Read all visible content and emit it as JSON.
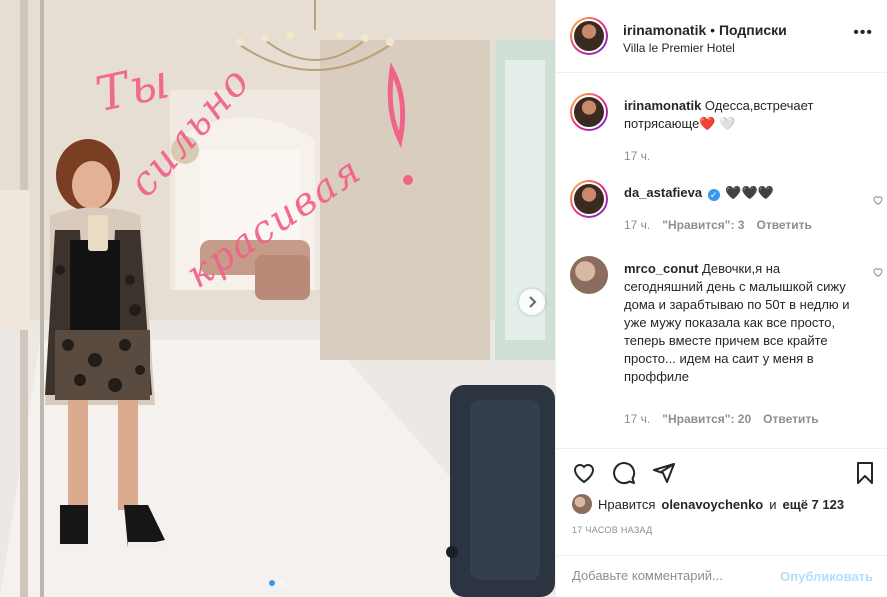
{
  "post": {
    "photo_alt": "",
    "lipstick_text": [
      "Ты",
      "сильно",
      "красивая"
    ],
    "carousel_dots": 2,
    "active_dot": 0
  },
  "header": {
    "username": "irinamonatik",
    "separator": "•",
    "follow_label": "Подписки",
    "location": "Villa le Premier Hotel",
    "more_icon": "more-horizontal-icon"
  },
  "caption": {
    "username": "irinamonatik",
    "text": "Одесса,встречает потрясающе",
    "emoji": "❤️ 🤍",
    "time": "17 ч."
  },
  "comments": [
    {
      "username": "da_astafieva",
      "verified": true,
      "text": "🖤🖤🖤",
      "time": "17 ч.",
      "likes_label": "\"Нравится\": 3",
      "reply_label": "Ответить"
    },
    {
      "username": "mrco_conut",
      "verified": false,
      "text": "Девочки,я на сегодняшний день с малышкой сижу дома и зарабтываю по 50т в недлю и уже мужу показала как все просто, теперь вместе причем все крайте просто... идем на саит у меня в проффиле",
      "time": "17 ч.",
      "likes_label": "\"Нравится\": 20",
      "reply_label": "Ответить"
    }
  ],
  "actions": {
    "like_icon": "heart-icon",
    "comment_icon": "comment-icon",
    "share_icon": "share-icon",
    "save_icon": "bookmark-icon"
  },
  "likes": {
    "prefix": "Нравится",
    "user": "olenavoychenko",
    "and": "и",
    "others": "ещё 7 123"
  },
  "timestamp": "17 ЧАСОВ НАЗАД",
  "add_comment": {
    "placeholder": "Добавьте комментарий...",
    "publish_label": "Опубликовать"
  },
  "colors": {
    "accent": "#3897f0",
    "publish_disabled": "#b2dffc",
    "lipstick": "#f0648a",
    "muted": "#8e8e8e"
  }
}
